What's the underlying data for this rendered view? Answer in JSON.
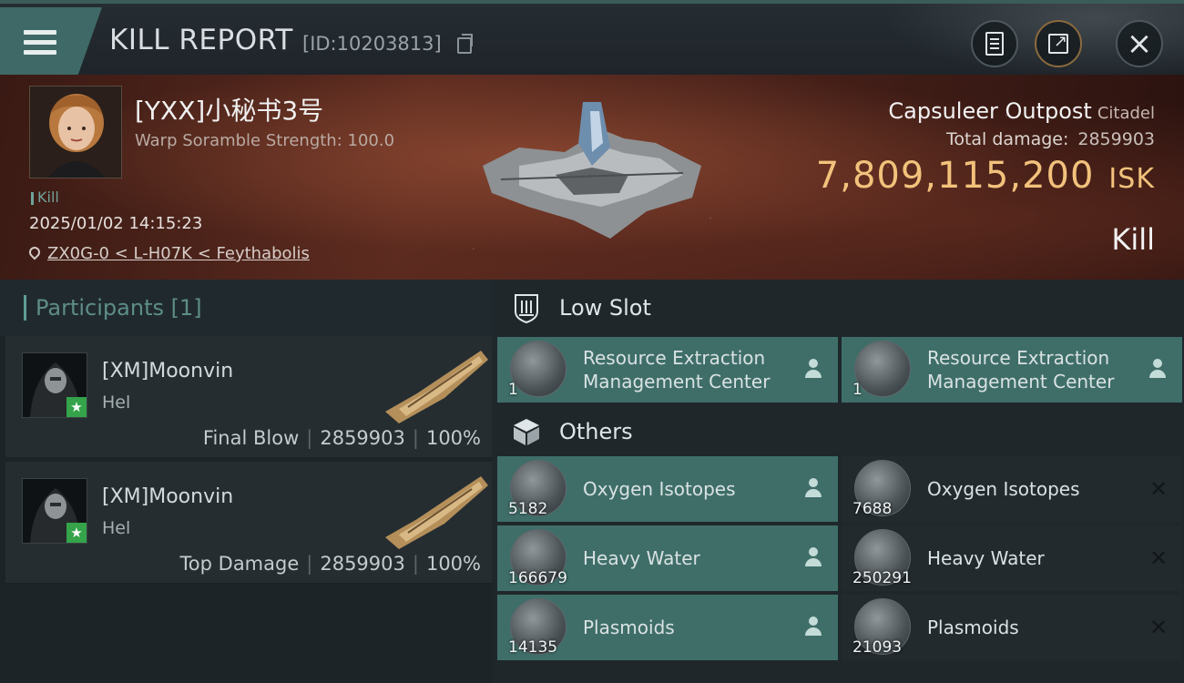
{
  "header": {
    "title": "KILL REPORT",
    "report_id": "[ID:10203813]"
  },
  "victim": {
    "name": "[YXX]小秘书3号",
    "subtitle": "Warp Soramble Strength: 100.0",
    "tag": "Kill",
    "datetime": "2025/01/02 14:15:23",
    "location": "ZX0G-0 < L-H07K < Feythabolis"
  },
  "target": {
    "name": "Capsuleer Outpost",
    "type": "Citadel",
    "total_damage_label": "Total damage:",
    "total_damage": "2859903",
    "isk_value": "7,809,115,200",
    "isk_unit": "ISK",
    "result": "Kill"
  },
  "participants": {
    "title": "Participants [1]",
    "rows": [
      {
        "name": "[XM]Moonvin",
        "ship": "Hel",
        "role": "Final Blow",
        "damage": "2859903",
        "percent": "100%"
      },
      {
        "name": "[XM]Moonvin",
        "ship": "Hel",
        "role": "Top Damage",
        "damage": "2859903",
        "percent": "100%"
      }
    ]
  },
  "loot": {
    "low_slot_title": "Low Slot",
    "others_title": "Others",
    "low_slot": [
      {
        "name": "Resource Extraction Management Center",
        "qty": "1",
        "status": "dropped"
      },
      {
        "name": "Resource Extraction Management Center",
        "qty": "1",
        "status": "dropped"
      }
    ],
    "others": [
      {
        "name": "Oxygen Isotopes",
        "qty": "5182",
        "status": "dropped"
      },
      {
        "name": "Oxygen Isotopes",
        "qty": "7688",
        "status": "destroyed"
      },
      {
        "name": "Heavy Water",
        "qty": "166679",
        "status": "dropped"
      },
      {
        "name": "Heavy Water",
        "qty": "250291",
        "status": "destroyed"
      },
      {
        "name": "Plasmoids",
        "qty": "14135",
        "status": "dropped"
      },
      {
        "name": "Plasmoids",
        "qty": "21093",
        "status": "destroyed"
      }
    ]
  },
  "colors": {
    "accent_teal": "#3f6e69",
    "isk_gold": "#f2c27c",
    "badge_green": "#34a34a"
  },
  "icons": [
    "menu-icon",
    "clipboard-icon",
    "share-icon",
    "close-icon",
    "copy-icon",
    "location-pin-icon",
    "low-slot-icon",
    "cube-icon",
    "person-icon",
    "x-icon",
    "star-icon"
  ]
}
